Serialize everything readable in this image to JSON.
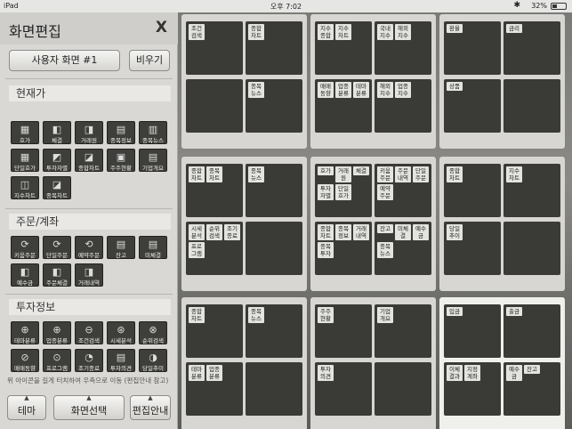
{
  "status": {
    "carrier": "iPad",
    "time": "오후 7:02",
    "battery": "32%"
  },
  "panel": {
    "title": "화면편집",
    "close": "X",
    "screen_button": "사용자 화면 #1",
    "clear_button": "비우기",
    "sections": [
      {
        "label": "현재가",
        "items": [
          "호가",
          "체결",
          "거래원",
          "종목정보",
          "종목뉴스",
          "단일호가",
          "투자자별",
          "종합차트",
          "주주현황",
          "기업개요",
          "지수차트",
          "종목차트"
        ]
      },
      {
        "label": "주문/계좌",
        "items": [
          "키움주문",
          "단일주문",
          "예약주문",
          "잔고",
          "미체결",
          "예수금",
          "주문체결",
          "거래내역"
        ]
      },
      {
        "label": "투자정보",
        "items": [
          "테마분류",
          "업종분류",
          "조건검색",
          "시세분석",
          "순위검색",
          "매매동향",
          "프로그램",
          "조기종료",
          "투자의견",
          "당일추이"
        ]
      }
    ],
    "hint": "위 아이콘을 길게 터치하여 우측으로 이동 (편집안내 참고)",
    "bottom": {
      "theme": "테마",
      "screen_select": "화면선택",
      "edit_guide": "편집안내"
    }
  },
  "pages": [
    {
      "cells": [
        [
          "조건 검색"
        ],
        [
          "종합 차트"
        ],
        [],
        [
          "종목 뉴스"
        ]
      ]
    },
    {
      "cells": [
        [
          "지수 종합",
          "지수 차트"
        ],
        [
          "국내 지수",
          "해외 지수"
        ],
        [
          "매매 동향",
          "업종 분류",
          "테마 분류"
        ],
        [
          "해외 지수",
          "업종 지수"
        ]
      ]
    },
    {
      "cells": [
        [
          "환율"
        ],
        [
          "금리"
        ],
        [
          "상품"
        ],
        []
      ]
    },
    {
      "cells": [
        [
          "종합 차트",
          "종목 차트"
        ],
        [
          "종목 뉴스"
        ],
        [
          "시세 분석",
          "순위 검색",
          "조기 종료",
          "프로 그램"
        ],
        []
      ]
    },
    {
      "cells": [
        [
          "호가",
          "거래 원",
          "체결",
          "투자 자별",
          "단일 호가"
        ],
        [
          "키움 주문",
          "주문 내역",
          "단일 주문",
          "예약 주문"
        ],
        [
          "종합 차트",
          "종목 정보",
          "거래 내역",
          "종목 투자"
        ],
        [
          "잔고",
          "미체 결",
          "예수 금",
          "종목 뉴스"
        ]
      ]
    },
    {
      "cells": [
        [
          "종합 차트"
        ],
        [
          "지수 차트"
        ],
        [
          "당일 추이"
        ],
        []
      ]
    },
    {
      "cells": [
        [
          "종합 차트"
        ],
        [
          "종목 뉴스"
        ],
        [
          "테마 분류",
          "업종 분류"
        ],
        []
      ]
    },
    {
      "cells": [
        [
          "주주 현황"
        ],
        [
          "기업 개요"
        ],
        [
          "투자 의견"
        ],
        []
      ]
    },
    {
      "cells": [
        [
          "입금"
        ],
        [
          "출금"
        ],
        [
          "이체 결과",
          "지정 계좌"
        ],
        [
          "예수 금",
          "잔고"
        ]
      ]
    }
  ]
}
